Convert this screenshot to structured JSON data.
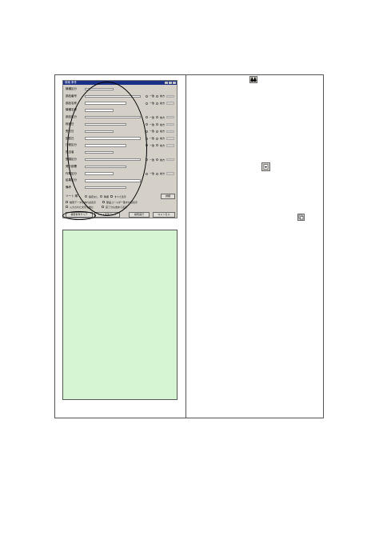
{
  "dialog": {
    "title": "検索 条件",
    "rows": [
      {
        "label": "機種区分",
        "has_radios": false
      },
      {
        "label": "部品番号",
        "has_radios": true
      },
      {
        "label": "部品名称",
        "has_radios": true
      },
      {
        "label": "機種名称",
        "has_radios": false
      },
      {
        "label": "部品区分",
        "has_radios": true
      },
      {
        "label": "検査日",
        "has_radios": true
      },
      {
        "label": "受付日",
        "has_radios": true
      },
      {
        "label": "回答日",
        "has_radios": true
      },
      {
        "label": "日程区分",
        "has_radios": true
      },
      {
        "label": "担当者",
        "has_radios": false
      },
      {
        "label": "受領区分",
        "has_radios": true
      },
      {
        "label": "発行部署",
        "has_radios": false
      },
      {
        "label": "作業区分",
        "has_radios": true
      },
      {
        "label": "結果区分",
        "has_radios": false
      },
      {
        "label": "備考",
        "has_radios": false
      }
    ],
    "radio_a": "一致",
    "radio_b": "前方",
    "options_label": "ソート 順",
    "option_items": [
      "指定なし",
      "降順",
      "すべて表示"
    ],
    "detail_button": "詳細",
    "check_items": [
      "検索データがあれば表示",
      "部品コードが一致すれば表示",
      "入力された文字を含む",
      "完了分も含めて表示"
    ],
    "bottom_buttons": [
      "検索条件クリア",
      "ソート条件クリア",
      "検索実行",
      "キャンセル"
    ]
  },
  "icons": [
    "binoculars-icon",
    "dropdown-icon",
    "copy-icon"
  ]
}
